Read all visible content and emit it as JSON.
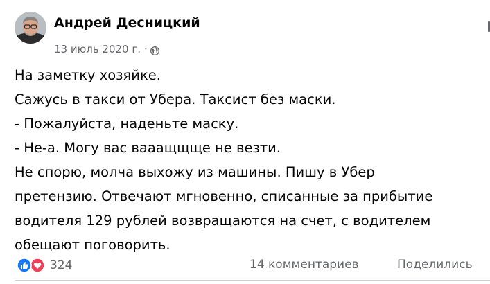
{
  "post": {
    "author": {
      "name": "Андрей Десницкий"
    },
    "meta": {
      "date": "13 июль 2020 г.",
      "separator": "·",
      "privacy_icon": "globe-icon"
    },
    "body_lines": [
      "На заметку хозяйке.",
      "Сажусь в такси от Убера. Таксист без маски.",
      "- Пожалуйста, наденьте маску.",
      "- Не-а. Могу вас вааащщще не везти.",
      "Не спорю, молча выхожу из машины. Пишу в Убер",
      "претензию. Отвечают мгновенно, списанные за прибытие",
      "водителя 129 рублей возвращаются на счет, с водителем",
      "обещают поговорить."
    ],
    "footer": {
      "reaction_icons": [
        "like-icon",
        "love-icon"
      ],
      "reaction_count": "324",
      "comments": "14 комментариев",
      "shares": "Поделились"
    }
  },
  "colors": {
    "text_primary": "#050505",
    "text_secondary": "#65676b",
    "like_blue": "#1877f2",
    "love_red": "#f33e58",
    "divider": "#ced0d4"
  }
}
